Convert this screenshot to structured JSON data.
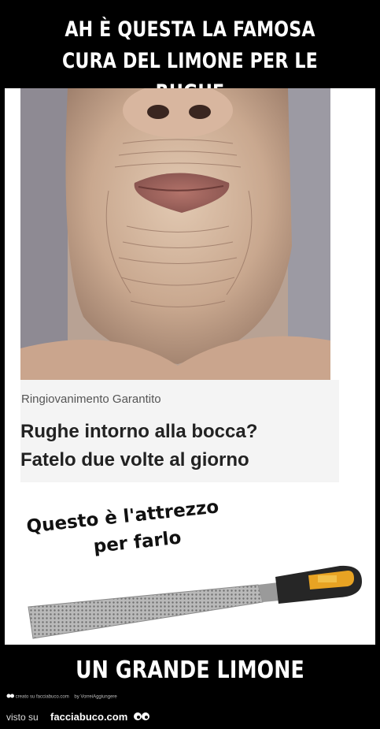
{
  "meme": {
    "top_text": "AH È QUESTA LA FAMOSA CURA DEL LIMONE PER LE RUGHE",
    "bottom_text": "UN GRANDE LIMONE"
  },
  "ad": {
    "source": "Ringiovanimento Garantito",
    "headline_line1": "Rughe intorno alla bocca?",
    "headline_line2": "Fatelo due volte al giorno"
  },
  "caption": {
    "line1": "Questo è l'attrezzo",
    "line2": "per farlo"
  },
  "credits": {
    "created_on": "creato su facciabuco.com",
    "by": "by VorreiAggiungere"
  },
  "footer": {
    "visto_su": "visto su",
    "site": "facciabuco.com"
  }
}
